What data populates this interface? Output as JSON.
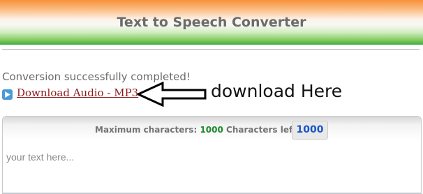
{
  "header": {
    "title": "Text to Speech Converter"
  },
  "status": {
    "message": "Conversion successfully completed!"
  },
  "download": {
    "link_label": "Download Audio - MP3"
  },
  "annotation": {
    "text": "download Here"
  },
  "editor": {
    "max_label": "Maximum characters:",
    "max_value": "1000",
    "left_label": "Characters left:",
    "left_value": "1000",
    "placeholder": "your text here..."
  },
  "colors": {
    "header_top": "#f7913a",
    "header_bottom": "#3fa93a",
    "link": "#8b1a1a",
    "max_value": "#1b8a2a",
    "left_value": "#1a56c4"
  },
  "icons": {
    "play": "play-icon",
    "arrow": "left-arrow-icon"
  }
}
